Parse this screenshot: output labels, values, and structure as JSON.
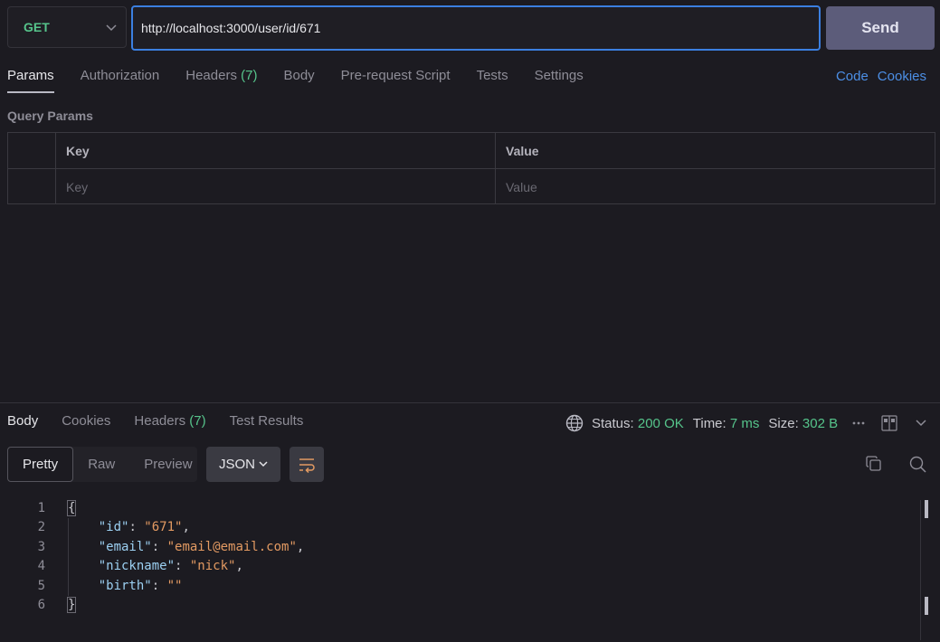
{
  "request": {
    "method": "GET",
    "url": "http://localhost:3000/user/id/671",
    "send_label": "Send"
  },
  "request_tabs": [
    {
      "label": "Params",
      "count": ""
    },
    {
      "label": "Authorization",
      "count": ""
    },
    {
      "label": "Headers",
      "count": "(7)"
    },
    {
      "label": "Body",
      "count": ""
    },
    {
      "label": "Pre-request Script",
      "count": ""
    },
    {
      "label": "Tests",
      "count": ""
    },
    {
      "label": "Settings",
      "count": ""
    }
  ],
  "links": {
    "code": "Code",
    "cookies": "Cookies"
  },
  "query_params": {
    "title": "Query Params",
    "headers": {
      "key": "Key",
      "value": "Value"
    },
    "placeholders": {
      "key": "Key",
      "value": "Value"
    }
  },
  "response_tabs": [
    {
      "label": "Body",
      "count": ""
    },
    {
      "label": "Cookies",
      "count": ""
    },
    {
      "label": "Headers",
      "count": "(7)"
    },
    {
      "label": "Test Results",
      "count": ""
    }
  ],
  "status": {
    "status_label": "Status:",
    "status_value": "200 OK",
    "time_label": "Time:",
    "time_value": "7 ms",
    "size_label": "Size:",
    "size_value": "302 B",
    "accent_color": "#56c48b"
  },
  "view": {
    "modes": [
      "Pretty",
      "Raw",
      "Preview"
    ],
    "format": "JSON"
  },
  "code_lines": [
    {
      "n": "1",
      "text": "{"
    },
    {
      "n": "2",
      "key": "\"id\"",
      "val": "\"671\"",
      "trail": ","
    },
    {
      "n": "3",
      "key": "\"email\"",
      "val": "\"email@email.com\"",
      "trail": ","
    },
    {
      "n": "4",
      "key": "\"nickname\"",
      "val": "\"nick\"",
      "trail": ","
    },
    {
      "n": "5",
      "key": "\"birth\"",
      "val": "\"\"",
      "trail": ""
    },
    {
      "n": "6",
      "text": "}"
    }
  ],
  "icons": [
    "chevron-down-icon",
    "globe-icon",
    "more-icon",
    "layout-icon",
    "copy-icon",
    "search-icon",
    "wrap-icon"
  ]
}
